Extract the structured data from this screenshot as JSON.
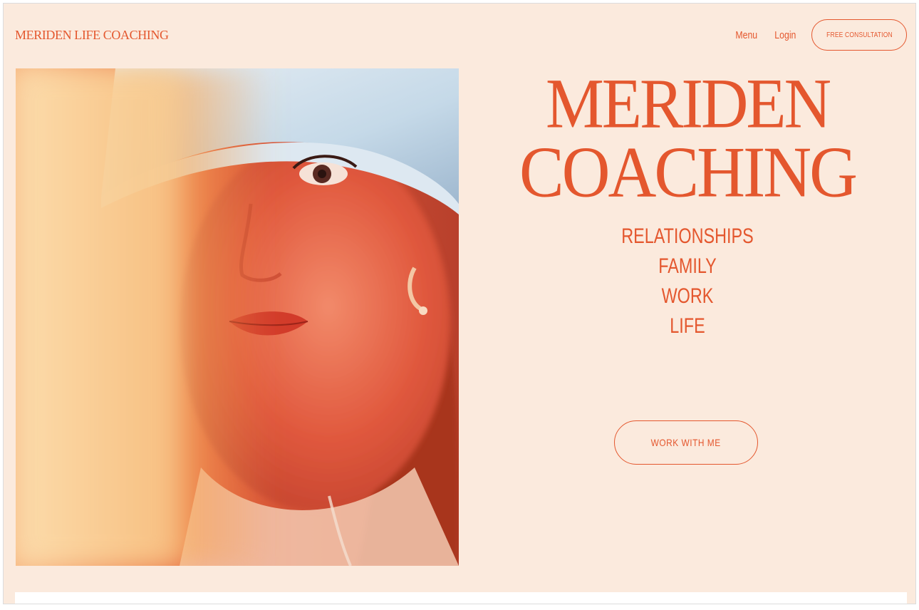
{
  "header": {
    "brand": "MERIDEN LIFE COACHING",
    "nav": {
      "menu": "Menu",
      "login": "Login",
      "cta": "FREE CONSULTATION"
    }
  },
  "hero": {
    "title_line1": "MERIDEN",
    "title_line2": "COACHING",
    "topics": [
      "RELATIONSHIPS",
      "FAMILY",
      "WORK",
      "LIFE"
    ],
    "cta": "WORK WITH ME",
    "photo": "portrait-photo"
  },
  "colors": {
    "accent": "#e4572e",
    "background": "#fbeadd"
  }
}
